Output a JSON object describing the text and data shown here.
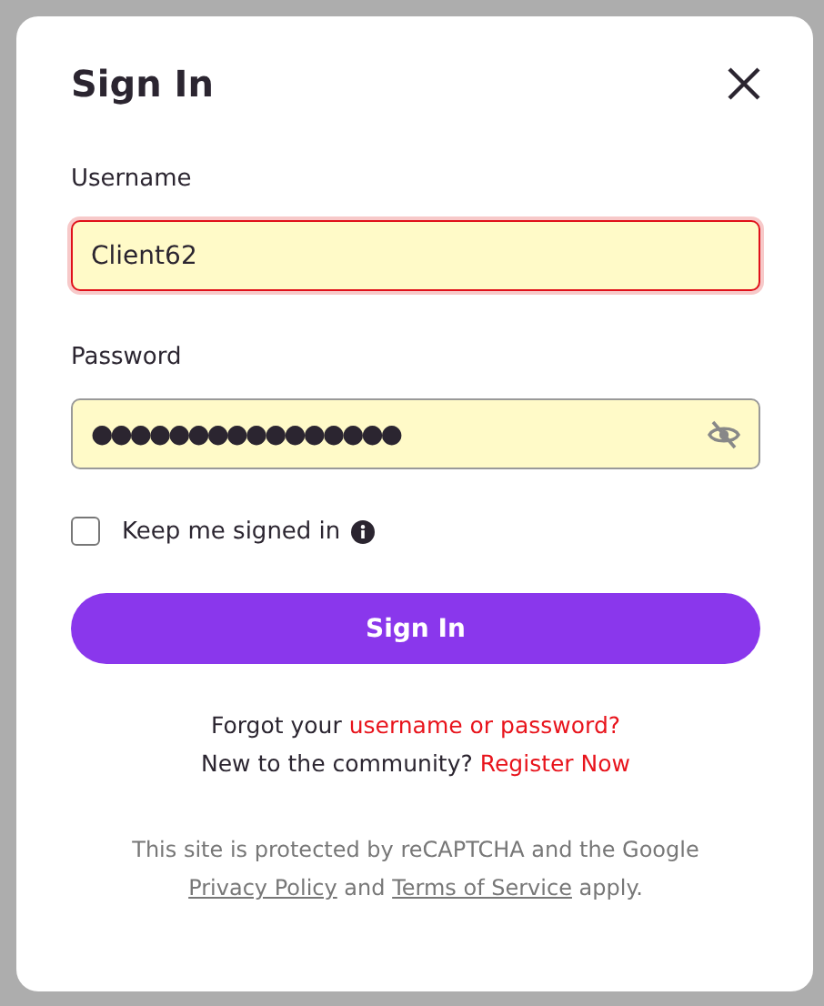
{
  "dialog": {
    "title": "Sign In",
    "username": {
      "label": "Username",
      "value": "Client62",
      "error": true
    },
    "password": {
      "label": "Password",
      "value": "●●●●●●●●●●●●●●●●",
      "revealed": false
    },
    "keep_signed_in": {
      "label": "Keep me signed in",
      "checked": false
    },
    "submit": "Sign In",
    "forgot": {
      "text": "Forgot your ",
      "link": "username or password?"
    },
    "register": {
      "text": "New to the community? ",
      "link": "Register Now"
    },
    "recaptcha": {
      "line1": "This site is protected by reCAPTCHA and the Google",
      "privacy": "Privacy Policy",
      "and": " and ",
      "terms": "Terms of Service",
      "end": " apply."
    }
  }
}
